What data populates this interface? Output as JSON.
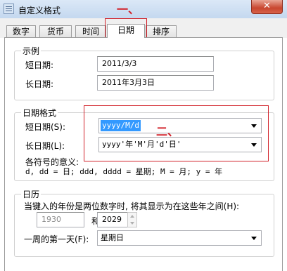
{
  "window": {
    "title": "自定义格式",
    "close_label": "✕"
  },
  "tabs": [
    {
      "label": "数字"
    },
    {
      "label": "货币"
    },
    {
      "label": "时间"
    },
    {
      "label": "日期",
      "active": true
    },
    {
      "label": "排序"
    }
  ],
  "example": {
    "title": "示例",
    "short_label": "短日期:",
    "short_value": "2011/3/3",
    "long_label": "长日期:",
    "long_value": "2011年3月3日"
  },
  "date_format": {
    "title": "日期格式",
    "short_label": "短日期(S):",
    "short_value": "yyyy/M/d",
    "long_label": "长日期(L):",
    "long_value": "yyyy'年'M'月'd'日'",
    "legend_title": "各符号的意义:",
    "legend_text": "d, dd = 日;  ddd, dddd = 星期;  M = 月;  y = 年"
  },
  "calendar": {
    "title": "日历",
    "two_digit_text": "当键入的年份是两位数字时, 将其显示为在这些年之间(H):",
    "from_year": "1930",
    "and_label": "和",
    "to_year": "2029",
    "first_day_label": "一周的第一天(F):",
    "first_day_value": "星期日"
  },
  "annotations": {
    "mark_one": "一、",
    "mark_two": "二、",
    "color": "#d2222a"
  }
}
